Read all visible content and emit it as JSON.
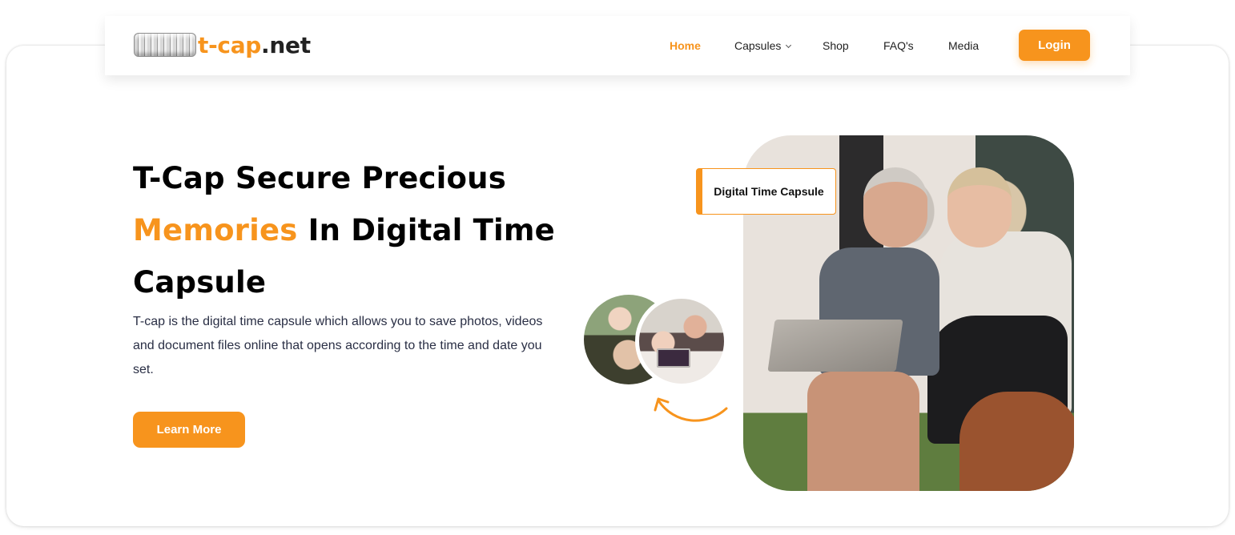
{
  "brand": {
    "logo_icon": "combination-lock-cylinder-icon",
    "name_part1": "t-cap",
    "name_part2": ".net",
    "accent_color": "#f7941d"
  },
  "nav": {
    "items": [
      {
        "label": "Home",
        "active": true
      },
      {
        "label": "Capsules",
        "has_dropdown": true
      },
      {
        "label": "Shop"
      },
      {
        "label": "FAQ's"
      },
      {
        "label": "Media"
      }
    ],
    "login_label": "Login"
  },
  "hero": {
    "title_part1": "T-Cap Secure Precious",
    "title_highlight": "Memories",
    "title_part2": " In Digital Time Capsule",
    "description": "T-cap is the digital time capsule which allows you to save photos, videos and document files online that opens according to the time and date you set.",
    "cta_label": "Learn More",
    "badge_label": "Digital Time Capsule",
    "images": {
      "main": "older couple with laptop and dog",
      "circle_1": "father with child on shoulders",
      "circle_2": "mother with children and tablet"
    }
  }
}
